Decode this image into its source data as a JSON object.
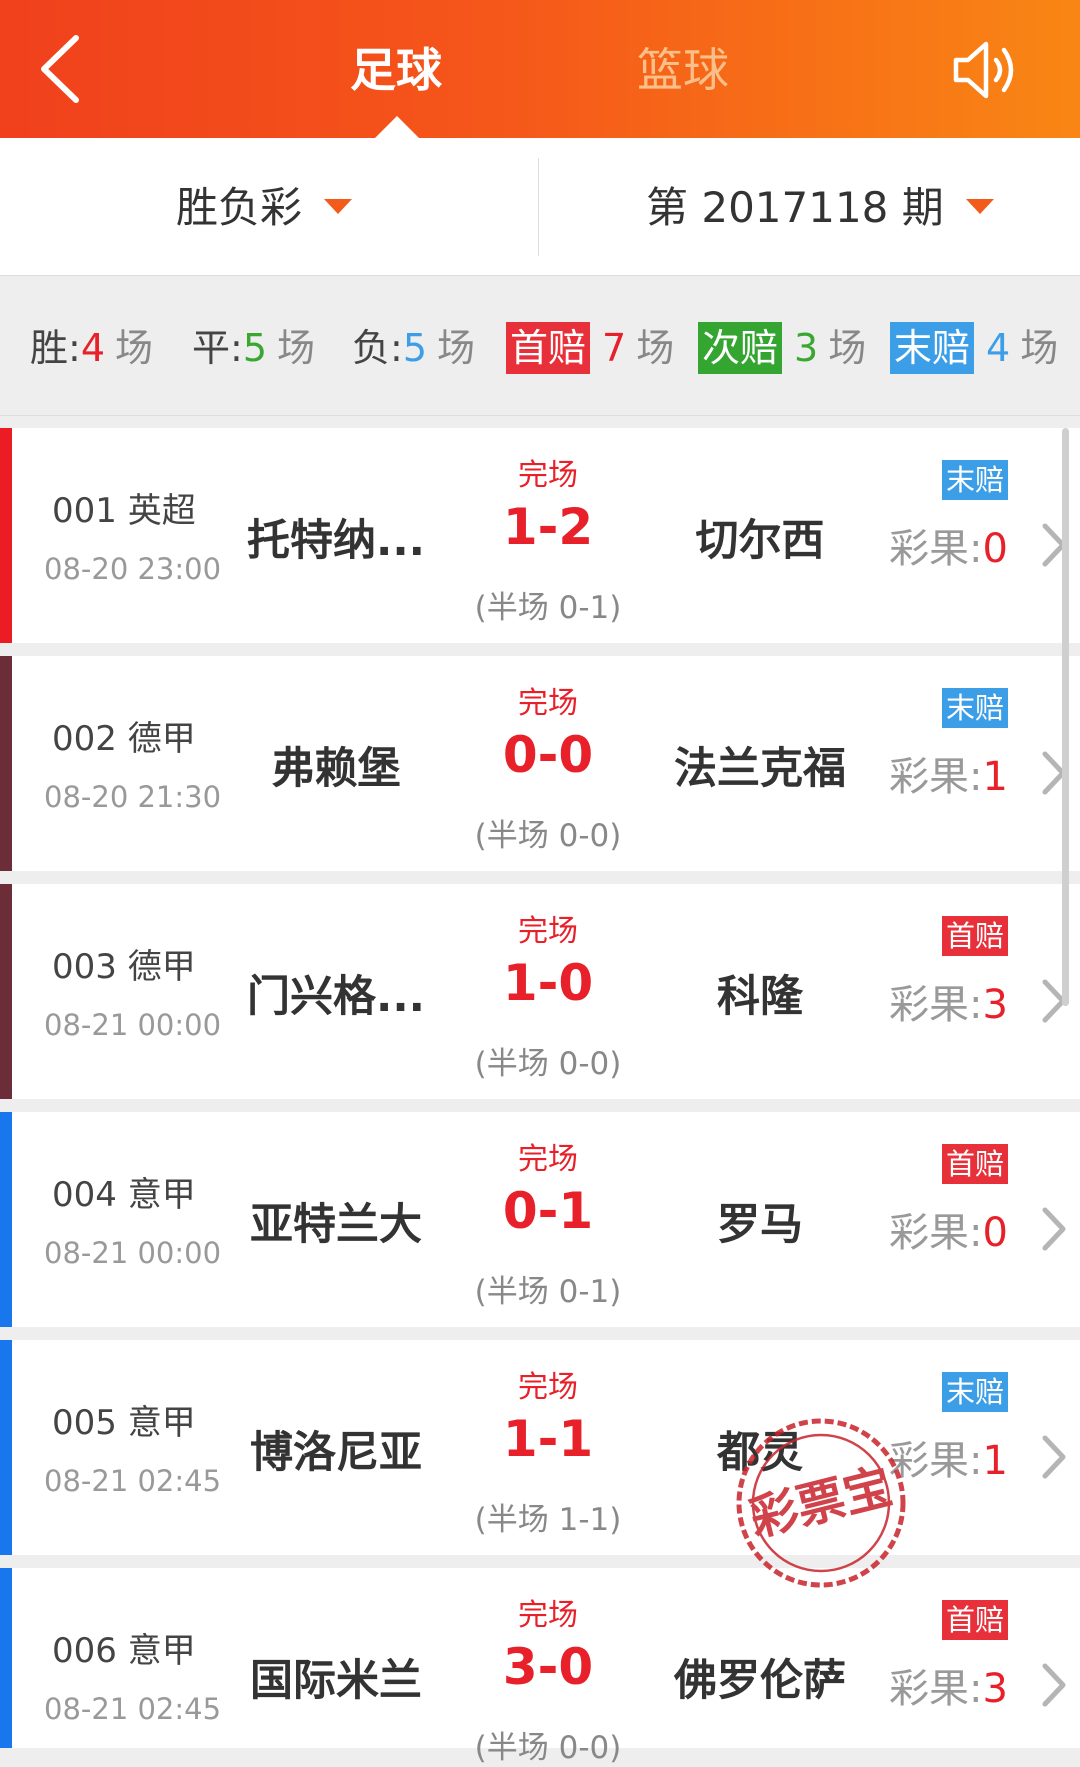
{
  "header": {
    "tab_football": "足球",
    "tab_basketball": "篮球"
  },
  "filter": {
    "type_label": "胜负彩",
    "period_label": "第 2017118 期"
  },
  "summary": {
    "win_label": "胜:",
    "win_count": "4",
    "win_unit": "场",
    "draw_label": "平:",
    "draw_count": "5",
    "draw_unit": "场",
    "lose_label": "负:",
    "lose_count": "5",
    "lose_unit": "场",
    "first_label": "首赔",
    "first_count": "7",
    "first_unit": "场",
    "second_label": "次赔",
    "second_count": "3",
    "second_unit": "场",
    "last_label": "末赔",
    "last_count": "4",
    "last_unit": "场"
  },
  "colors": {
    "header_start": "#f0401c",
    "header_end": "#f98614",
    "accent_red": "#e8202a",
    "first_odds": "#e8303a",
    "second_odds": "#33a530",
    "last_odds": "#3d9ee8",
    "bar_red": "#ec1c24",
    "bar_maroon": "#6b2d38",
    "bar_blue": "#1977ee"
  },
  "stamp_text": "彩票宝",
  "matches": [
    {
      "code": "001 英超",
      "time": "08-20 23:00",
      "home": "托特纳...",
      "away": "切尔西",
      "status": "完场",
      "score": "1-2",
      "half": "(半场 0-1)",
      "odds": "末赔",
      "result_label": "彩果:",
      "result_value": "0"
    },
    {
      "code": "002 德甲",
      "time": "08-20 21:30",
      "home": "弗赖堡",
      "away": "法兰克福",
      "status": "完场",
      "score": "0-0",
      "half": "(半场 0-0)",
      "odds": "末赔",
      "result_label": "彩果:",
      "result_value": "1"
    },
    {
      "code": "003 德甲",
      "time": "08-21 00:00",
      "home": "门兴格...",
      "away": "科隆",
      "status": "完场",
      "score": "1-0",
      "half": "(半场 0-0)",
      "odds": "首赔",
      "result_label": "彩果:",
      "result_value": "3"
    },
    {
      "code": "004 意甲",
      "time": "08-21 00:00",
      "home": "亚特兰大",
      "away": "罗马",
      "status": "完场",
      "score": "0-1",
      "half": "(半场 0-1)",
      "odds": "首赔",
      "result_label": "彩果:",
      "result_value": "0"
    },
    {
      "code": "005 意甲",
      "time": "08-21 02:45",
      "home": "博洛尼亚",
      "away": "都灵",
      "status": "完场",
      "score": "1-1",
      "half": "(半场 1-1)",
      "odds": "末赔",
      "result_label": "彩果:",
      "result_value": "1"
    },
    {
      "code": "006 意甲",
      "time": "08-21 02:45",
      "home": "国际米兰",
      "away": "佛罗伦萨",
      "status": "完场",
      "score": "3-0",
      "half": "(半场 0-0)",
      "odds": "首赔",
      "result_label": "彩果:",
      "result_value": "3"
    }
  ]
}
